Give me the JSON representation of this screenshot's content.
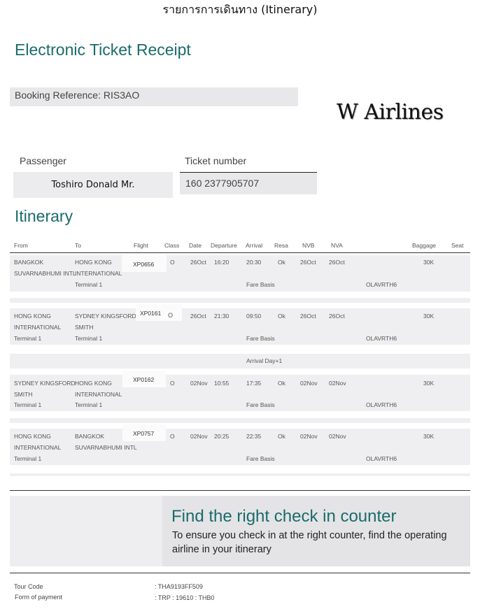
{
  "document": {
    "title": "รายการการเดินทาง (Itinerary)",
    "receipt_title": "Electronic Ticket Receipt",
    "booking_reference": "Booking Reference: RIS3AO",
    "airline_logo": "W Airlines"
  },
  "passenger": {
    "label": "Passenger",
    "name": "Toshiro Donald Mr."
  },
  "ticket": {
    "label": "Ticket number",
    "number": "160 2377905707"
  },
  "itinerary": {
    "title": "Itinerary",
    "headers": {
      "from": "From",
      "to": "To",
      "flight": "Flight",
      "class": "Class",
      "date": "Date",
      "departure": "Departure",
      "arrival": "Arrival",
      "resa": "Resa",
      "nvb": "NVB",
      "nva": "NVA",
      "baggage": "Baggage",
      "seat": "Seat"
    },
    "segments": [
      {
        "from_1": "BANGKOK",
        "from_2": "SUVARNABHUMI INTL",
        "from_terminal": "",
        "to_1": "HONG KONG",
        "to_2": "INTERNATIONAL",
        "to_terminal": "Terminal 1",
        "flight": "XP0656",
        "class": "O",
        "date": "26Oct",
        "departure": "16:20",
        "arrival": "20:30",
        "resa": "Ok",
        "nvb": "26Oct",
        "nva": "26Oct",
        "baggage": "30K",
        "fare_basis_label": "Fare Basis",
        "fare_basis": "OLAVRTH6"
      },
      {
        "from_1": "HONG KONG",
        "from_2": "INTERNATIONAL",
        "from_terminal": "Terminal 1",
        "to_1": "SYDNEY KINGSFORD",
        "to_2": "SMITH",
        "to_terminal": "Terminal 1",
        "flight": "XP0161",
        "class": "O",
        "date": "26Oct",
        "departure": "21:30",
        "arrival": "09:50",
        "resa": "Ok",
        "nvb": "26Oct",
        "nva": "26Oct",
        "baggage": "30K",
        "fare_basis_label": "Fare Basis",
        "fare_basis": "OLAVRTH6"
      },
      {
        "from_1": "SYDNEY KINGSFORD",
        "from_2": "SMITH",
        "from_terminal": "Terminal 1",
        "to_1": "HONG KONG",
        "to_2": "INTERNATIONAL",
        "to_terminal": "Terminal 1",
        "flight": "XP0162",
        "class": "O",
        "date": "02Nov",
        "departure": "10:55",
        "arrival": "17:35",
        "resa": "Ok",
        "nvb": "02Nov",
        "nva": "02Nov",
        "baggage": "30K",
        "fare_basis_label": "Fare Basis",
        "fare_basis": "OLAVRTH6"
      },
      {
        "from_1": "HONG KONG",
        "from_2": "INTERNATIONAL",
        "from_terminal": "Terminal 1",
        "to_1": "BANGKOK",
        "to_2": "SUVARNABHUMI INTL",
        "to_terminal": "",
        "flight": "XP0757",
        "class": "O",
        "date": "02Nov",
        "departure": "20:25",
        "arrival": "22:35",
        "resa": "Ok",
        "nvb": "02Nov",
        "nva": "02Nov",
        "baggage": "30K",
        "fare_basis_label": "Fare Basis",
        "fare_basis": "OLAVRTH6"
      }
    ],
    "arrival_note": "Arrival Day+1"
  },
  "promo": {
    "title": "Find the right check in counter",
    "body": "To ensure you check in at the right counter, find the operating airline in your itinerary"
  },
  "footer": {
    "tour_code_label": "Tour Code",
    "tour_code_value": ": THA9193FF509",
    "payment_label": "Form of payment",
    "payment_value": ": TRP : 19610 : THB0"
  },
  "colors": {
    "accent": "#1b6b6b",
    "panel": "#efeff1"
  }
}
